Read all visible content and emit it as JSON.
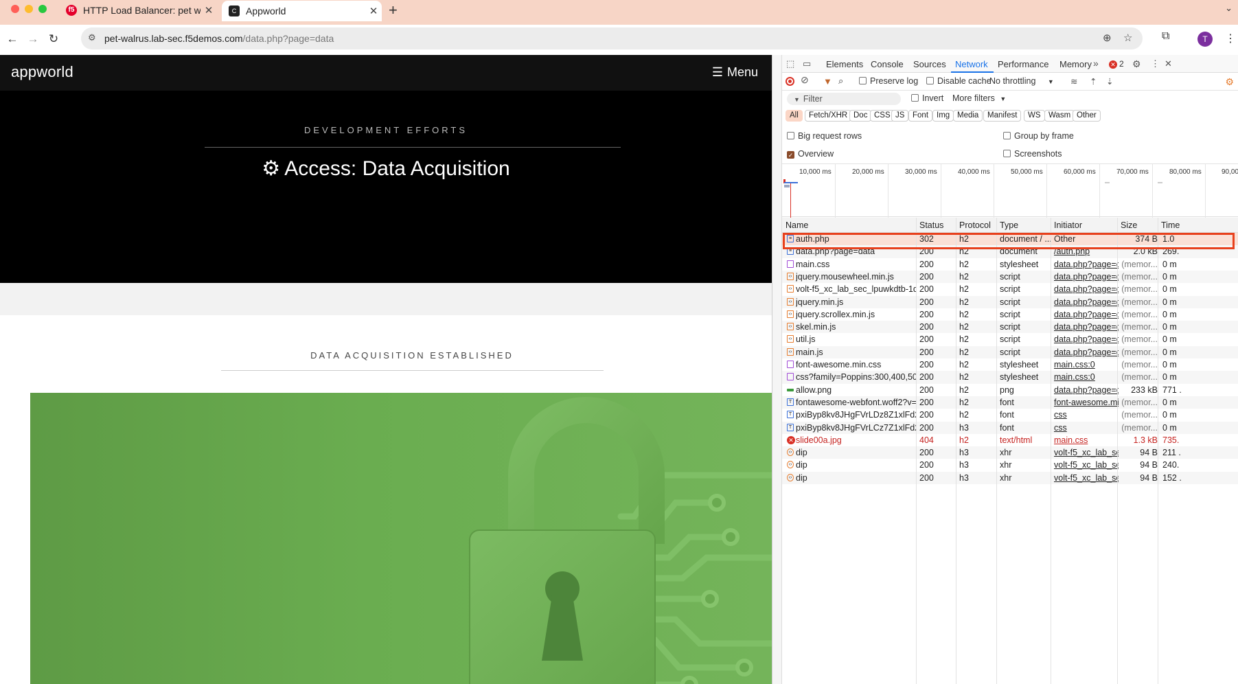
{
  "browser": {
    "tabs": [
      {
        "title": "HTTP Load Balancer: pet walrus",
        "favicon": "f5-icon"
      },
      {
        "title": "Appworld",
        "favicon": "appworld-icon"
      }
    ],
    "url_host": "pet-walrus.lab-sec.f5demos.com",
    "url_path": "/data.php?page=data",
    "profile_initial": "T"
  },
  "site": {
    "logo": "appworld",
    "menu_label": "Menu",
    "hero_eyebrow": "DEVELOPMENT EFFORTS",
    "hero_title": "Access: Data Acquisition",
    "section_eyebrow": "DATA ACQUISITION ESTABLISHED"
  },
  "devtools": {
    "tabs": [
      "Elements",
      "Console",
      "Sources",
      "Network",
      "Performance",
      "Memory"
    ],
    "active_tab": "Network",
    "error_count": "2",
    "toolbar": {
      "preserve_log": "Preserve log",
      "disable_cache": "Disable cache",
      "throttling": "No throttling"
    },
    "filter_placeholder": "Filter",
    "invert": "Invert",
    "more_filters": "More filters",
    "type_filters": [
      "All",
      "Fetch/XHR",
      "Doc",
      "CSS",
      "JS",
      "Font",
      "Img",
      "Media",
      "Manifest",
      "WS",
      "Wasm",
      "Other"
    ],
    "options": {
      "big_request_rows": "Big request rows",
      "group_by_frame": "Group by frame",
      "overview": "Overview",
      "screenshots": "Screenshots"
    },
    "timeline_labels": [
      "10,000 ms",
      "20,000 ms",
      "30,000 ms",
      "40,000 ms",
      "50,000 ms",
      "60,000 ms",
      "70,000 ms",
      "80,000 ms",
      "90,00"
    ],
    "columns": [
      "Name",
      "Status",
      "Protocol",
      "Type",
      "Initiator",
      "Size",
      "Time"
    ],
    "requests": [
      {
        "name": "auth.php",
        "status": "302",
        "protocol": "h2",
        "type": "document / ...",
        "initiator": "Other",
        "size": "374 B",
        "time": "1.0",
        "kind": "doc"
      },
      {
        "name": "data.php?page=data",
        "status": "200",
        "protocol": "h2",
        "type": "document",
        "initiator": "/auth.php",
        "size": "2.0 kB",
        "time": "269.",
        "kind": "doc"
      },
      {
        "name": "main.css",
        "status": "200",
        "protocol": "h2",
        "type": "stylesheet",
        "initiator": "data.php?page=dat",
        "size": "(memor...",
        "time": "0 m",
        "kind": "css"
      },
      {
        "name": "jquery.mousewheel.min.js",
        "status": "200",
        "protocol": "h2",
        "type": "script",
        "initiator": "data.php?page=dat",
        "size": "(memor...",
        "time": "0 m",
        "kind": "js"
      },
      {
        "name": "volt-f5_xc_lab_sec_lpuwkdtb-1d...",
        "status": "200",
        "protocol": "h2",
        "type": "script",
        "initiator": "data.php?page=dat",
        "size": "(memor...",
        "time": "0 m",
        "kind": "js"
      },
      {
        "name": "jquery.min.js",
        "status": "200",
        "protocol": "h2",
        "type": "script",
        "initiator": "data.php?page=dat",
        "size": "(memor...",
        "time": "0 m",
        "kind": "js"
      },
      {
        "name": "jquery.scrollex.min.js",
        "status": "200",
        "protocol": "h2",
        "type": "script",
        "initiator": "data.php?page=dat",
        "size": "(memor...",
        "time": "0 m",
        "kind": "js"
      },
      {
        "name": "skel.min.js",
        "status": "200",
        "protocol": "h2",
        "type": "script",
        "initiator": "data.php?page=dat",
        "size": "(memor...",
        "time": "0 m",
        "kind": "js"
      },
      {
        "name": "util.js",
        "status": "200",
        "protocol": "h2",
        "type": "script",
        "initiator": "data.php?page=dat",
        "size": "(memor...",
        "time": "0 m",
        "kind": "js"
      },
      {
        "name": "main.js",
        "status": "200",
        "protocol": "h2",
        "type": "script",
        "initiator": "data.php?page=dat",
        "size": "(memor...",
        "time": "0 m",
        "kind": "js"
      },
      {
        "name": "font-awesome.min.css",
        "status": "200",
        "protocol": "h2",
        "type": "stylesheet",
        "initiator": "main.css:0",
        "size": "(memor...",
        "time": "0 m",
        "kind": "css"
      },
      {
        "name": "css?family=Poppins:300,400,50...",
        "status": "200",
        "protocol": "h2",
        "type": "stylesheet",
        "initiator": "main.css:0",
        "size": "(memor...",
        "time": "0 m",
        "kind": "css"
      },
      {
        "name": "allow.png",
        "status": "200",
        "protocol": "h2",
        "type": "png",
        "initiator": "data.php?page=dat",
        "size": "233 kB",
        "time": "771 .",
        "kind": "img"
      },
      {
        "name": "fontawesome-webfont.woff2?v=...",
        "status": "200",
        "protocol": "h2",
        "type": "font",
        "initiator": "font-awesome.min.",
        "size": "(memor...",
        "time": "0 m",
        "kind": "font"
      },
      {
        "name": "pxiByp8kv8JHgFVrLDz8Z1xlFd2...",
        "status": "200",
        "protocol": "h2",
        "type": "font",
        "initiator": "css",
        "size": "(memor...",
        "time": "0 m",
        "kind": "font"
      },
      {
        "name": "pxiByp8kv8JHgFVrLCz7Z1xlFd2...",
        "status": "200",
        "protocol": "h3",
        "type": "font",
        "initiator": "css",
        "size": "(memor...",
        "time": "0 m",
        "kind": "font"
      },
      {
        "name": "slide00a.jpg",
        "status": "404",
        "protocol": "h2",
        "type": "text/html",
        "initiator": "main.css",
        "size": "1.3 kB",
        "time": "735.",
        "kind": "err"
      },
      {
        "name": "dip",
        "status": "200",
        "protocol": "h3",
        "type": "xhr",
        "initiator": "volt-f5_xc_lab_sec",
        "size": "94 B",
        "time": "211 .",
        "kind": "xhr"
      },
      {
        "name": "dip",
        "status": "200",
        "protocol": "h3",
        "type": "xhr",
        "initiator": "volt-f5_xc_lab_sec",
        "size": "94 B",
        "time": "240.",
        "kind": "xhr"
      },
      {
        "name": "dip",
        "status": "200",
        "protocol": "h3",
        "type": "xhr",
        "initiator": "volt-f5_xc_lab_sec",
        "size": "94 B",
        "time": "152 .",
        "kind": "xhr"
      }
    ]
  }
}
